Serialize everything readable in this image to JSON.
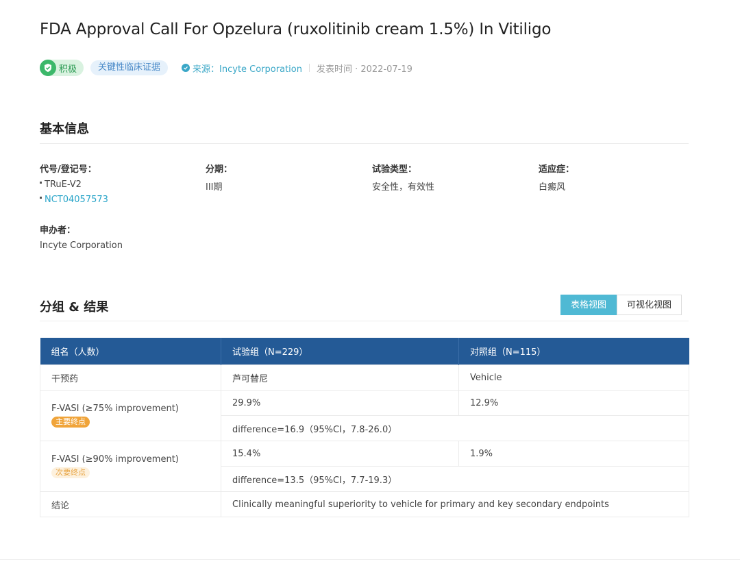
{
  "title": "FDA Approval Call For Opzelura (ruxolitinib cream 1.5%) In Vitiligo",
  "badges": {
    "positive": "积极",
    "evidence": "关键性临床证据"
  },
  "source": {
    "label": "来源：Incyte Corporation"
  },
  "publish": {
    "label": "发表时间 · 2022-07-19"
  },
  "basic_info": {
    "section_title": "基本信息",
    "code_label": "代号/登记号：",
    "codes": [
      "TRuE-V2",
      "NCT04057573"
    ],
    "phase_label": "分期：",
    "phase_value": "III期",
    "trial_type_label": "试验类型：",
    "trial_type_value": "安全性，有效性",
    "indication_label": "适应症：",
    "indication_value": "白癜风",
    "sponsor_label": "申办者：",
    "sponsor_value": "Incyte Corporation"
  },
  "results": {
    "section_title": "分组 & 结果",
    "view_table": "表格视图",
    "view_visual": "可视化视图",
    "headers": [
      "组名（人数）",
      "试验组（N=229）",
      "对照组（N=115）"
    ],
    "rows": {
      "intervention": {
        "label": "干预药",
        "trial": "芦可替尼",
        "control": "Vehicle"
      },
      "fvasi75": {
        "label": "F-VASI (≥75% improvement)",
        "tag": "主要终点",
        "trial": "29.9%",
        "control": "12.9%",
        "difference": "difference=16.9（95%CI，7.8-26.0）"
      },
      "fvasi90": {
        "label": "F-VASI (≥90% improvement)",
        "tag": "次要终点",
        "trial": "15.4%",
        "control": "1.9%",
        "difference": "difference=13.5（95%CI，7.7-19.3）"
      },
      "conclusion": {
        "label": "结论",
        "text": "Clinically meaningful superiority to vehicle for primary and key secondary endpoints"
      }
    }
  },
  "colors": {
    "table_header": "#245a96",
    "accent": "#4fb9d4",
    "positive": "#3cb86a",
    "primary_tag": "#f0a43a"
  }
}
